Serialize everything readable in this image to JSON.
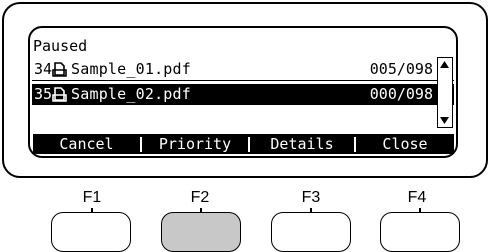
{
  "screen": {
    "status": "Paused",
    "jobs": [
      {
        "number": "34",
        "icon": "document-icon",
        "name": "Sample_01.pdf",
        "pages": "005/098",
        "state_icon": "pause-icon",
        "selected": false
      },
      {
        "number": "35",
        "icon": "document-icon",
        "name": "Sample_02.pdf",
        "pages": "000/098",
        "state_icon": "pause-icon",
        "selected": true
      }
    ],
    "scrollbar": {
      "up_icon": "scroll-up-arrow-icon",
      "down_icon": "scroll-down-arrow-icon"
    },
    "function_labels": [
      "Cancel",
      "Priority",
      "Details",
      "Close"
    ]
  },
  "keys": [
    {
      "caption": "F1",
      "pressed": false
    },
    {
      "caption": "F2",
      "pressed": true
    },
    {
      "caption": "F3",
      "pressed": false
    },
    {
      "caption": "F4",
      "pressed": false
    }
  ],
  "colors": {
    "lcd_foreground": "#000000",
    "lcd_background": "#ffffff",
    "pressed_key": "#c8c8c8"
  }
}
